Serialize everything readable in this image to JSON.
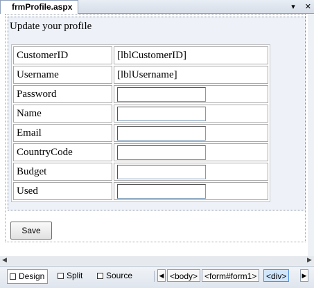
{
  "tab": {
    "title": "frmProfile.aspx",
    "pin_glyph": "▾",
    "close_glyph": "✕"
  },
  "form": {
    "heading": "Update your profile",
    "rows": [
      {
        "label": "CustomerID",
        "value": "[lblCustomerID]",
        "kind": "label"
      },
      {
        "label": "Username",
        "value": "[lblUsername]",
        "kind": "label"
      },
      {
        "label": "Password",
        "value": "",
        "kind": "textbox"
      },
      {
        "label": "Name",
        "value": "",
        "kind": "textbox"
      },
      {
        "label": "Email",
        "value": "",
        "kind": "textbox"
      },
      {
        "label": "CountryCode",
        "value": "",
        "kind": "textbox"
      },
      {
        "label": "Budget",
        "value": "",
        "kind": "textbox"
      },
      {
        "label": "Used",
        "value": "",
        "kind": "textbox"
      }
    ],
    "save_label": "Save"
  },
  "bottom": {
    "views": [
      "Design",
      "Split",
      "Source"
    ],
    "active_view": "Design",
    "tags": [
      "<body>",
      "<form#form1>",
      "<div>"
    ],
    "active_tag": "<div>"
  }
}
